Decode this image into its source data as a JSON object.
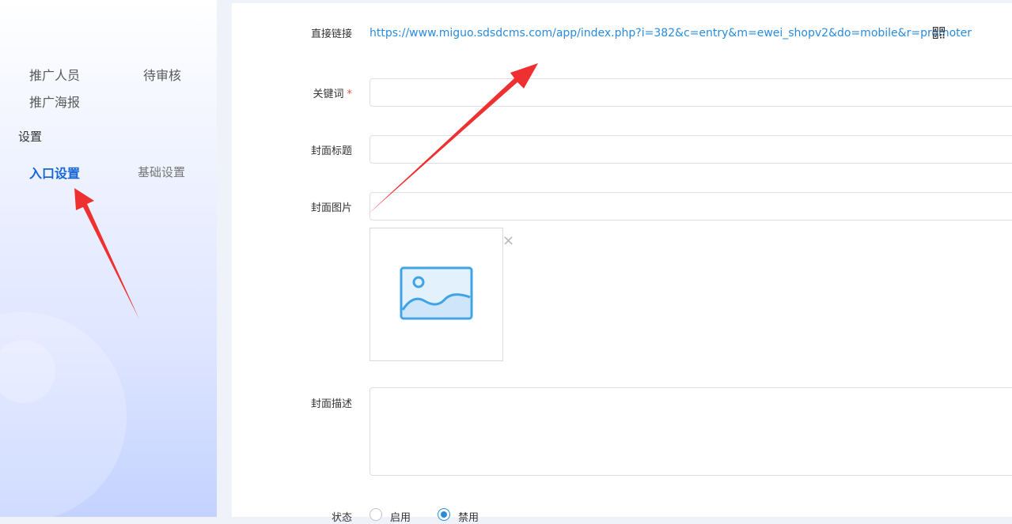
{
  "sidebar": {
    "items": [
      {
        "label": "推广人员"
      },
      {
        "label": "待审核"
      },
      {
        "label": "推广海报"
      }
    ],
    "section_title": "设置",
    "settings_items": [
      {
        "label": "入口设置",
        "active": true
      },
      {
        "label": "基础设置",
        "active": false
      }
    ]
  },
  "form": {
    "direct_link_label": "直接链接",
    "direct_link_value": "https://www.miguo.sdsdcms.com/app/index.php?i=382&c=entry&m=ewei_shopv2&do=mobile&r=promoter",
    "keyword_label": "关键词",
    "required_mark": "*",
    "keyword_value": "",
    "cover_title_label": "封面标题",
    "cover_title_value": "",
    "cover_image_label": "封面图片",
    "cover_image_value": "",
    "close_symbol": "×",
    "cover_desc_label": "封面描述",
    "status_label": "状态",
    "status_options": [
      {
        "label": "启用",
        "checked": false
      },
      {
        "label": "禁用",
        "checked": true
      }
    ]
  },
  "icons": {
    "qr": "qr-code-icon",
    "image_placeholder": "image-placeholder-icon",
    "close": "close-icon"
  },
  "colors": {
    "accent": "#2a8bdc",
    "active_nav": "#1767d6",
    "required": "#e74c3c",
    "annotation_arrow": "#ee3030"
  }
}
